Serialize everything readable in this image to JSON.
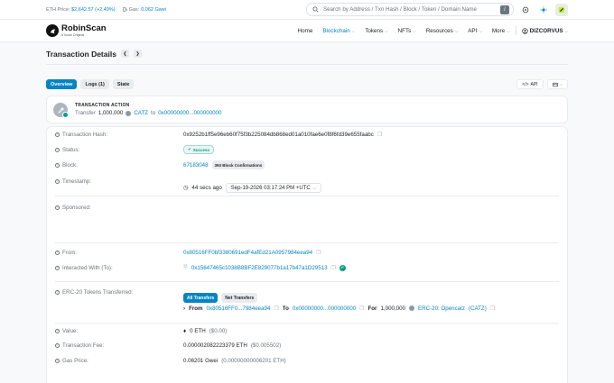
{
  "topbar": {
    "eth_price_label": "ETH Price:",
    "eth_price_value": "$2,642.57 (+2.49%)",
    "gas_label": "Gas:",
    "gas_value": "0.062 Gwei",
    "search_placeholder": "Search by Address / Txn Hash / Block / Token / Domain Name",
    "search_shortcut": "/"
  },
  "brand": {
    "name": "RobinScan",
    "tagline": "a Iocan Original"
  },
  "nav": {
    "home": "Home",
    "blockchain": "Blockchain",
    "tokens": "Tokens",
    "nfts": "NFTs",
    "resources": "Resources",
    "api": "API",
    "more": "More",
    "user": "DIZCORVUS"
  },
  "page": {
    "title": "Transaction Details"
  },
  "tabs": {
    "overview": "Overview",
    "logs": "Logs (1)",
    "state": "State"
  },
  "tools": {
    "api": "API"
  },
  "action": {
    "title": "TRANSACTION ACTION",
    "verb": "Transfer",
    "amount": "1,000,000",
    "token": "CATZ",
    "to_word": "to",
    "to_address": "0x00000000...000000000"
  },
  "details": {
    "hash_label": "Transaction Hash:",
    "hash_value": "0x9252b1ff5e96eb60f75f3b225084db868ed01a010fae6e0f8f6fd39e655faabc",
    "status_label": "Status:",
    "status_value": "Success",
    "block_label": "Block:",
    "block_value": "67183048",
    "block_confirm": "393 Block Confirmations",
    "timestamp_label": "Timestamp:",
    "timestamp_ago": "44 secs ago",
    "timestamp_value": "Sep-19-2026 03:17:24 PM +UTC",
    "sponsored_label": "Sponsored:",
    "from_label": "From:",
    "from_value": "0x80516FF0bf3380691edF4afEd21A0957984eea94",
    "interacted_label": "Interacted With (To):",
    "interacted_value": "0x15647465c1038B8BF2E829077b1a17b47a1D29513",
    "erc20_label": "ERC-20 Tokens Transferred:",
    "erc20_tab_all": "All Transfers",
    "erc20_tab_net": "Net Transfers",
    "erc20_from_word": "From",
    "erc20_from": "0x80516FF0...7984eea94",
    "erc20_to_word": "To",
    "erc20_to": "0x00000000...000000000",
    "erc20_for_word": "For",
    "erc20_amount": "1,000,000",
    "erc20_token": "ERC-20: Opencatz",
    "erc20_symbol": "(CATZ)",
    "value_label": "Value:",
    "value_value": "0 ETH",
    "value_usd": "($0.00)",
    "fee_label": "Transaction Fee:",
    "fee_value": "0.000002082223379 ETH",
    "fee_usd": "($0.005502)",
    "gas_label": "Gas Price:",
    "gas_value": "0.06201 Gwei",
    "gas_eth": "(0.00000000006201 ETH)"
  },
  "colors": {
    "accent": "#0784c3",
    "success": "#00a186"
  }
}
